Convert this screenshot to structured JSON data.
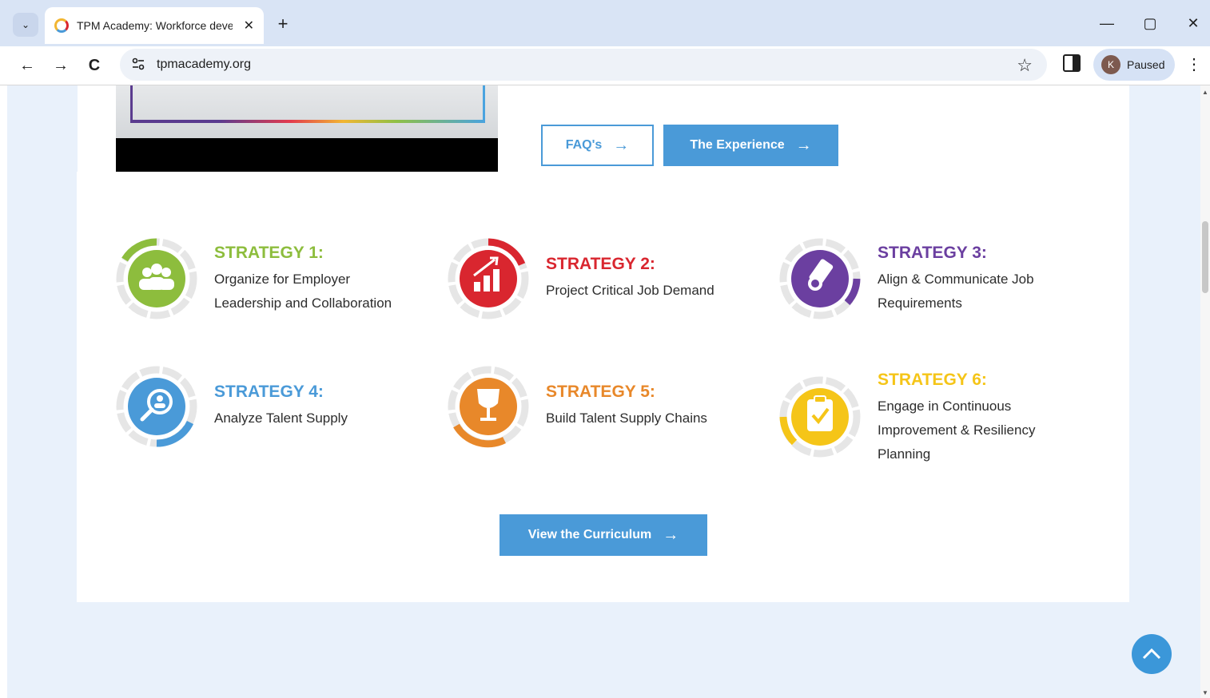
{
  "browser": {
    "tab_title": "TPM Academy: Workforce deve",
    "tab_close": "✕",
    "new_tab": "+",
    "tab_search": "⌄",
    "url": "tpmacademy.org",
    "profile_label": "Paused",
    "profile_initial": "K",
    "win_minimize": "—",
    "win_restore": "▢",
    "win_close": "✕",
    "back": "←",
    "forward": "→",
    "reload": "C",
    "star": "☆",
    "menu": "⋮"
  },
  "hero_buttons": {
    "faq_label": "FAQ's",
    "experience_label": "The Experience",
    "arrow": "→"
  },
  "strategies": [
    {
      "title": "STRATEGY 1:",
      "desc_lines": [
        "Organize for Employer",
        "Leadership and Collaboration"
      ],
      "color": "#8dbd3d",
      "icon": "people-group-icon"
    },
    {
      "title": "STRATEGY 2:",
      "desc_lines": [
        "Project Critical Job Demand"
      ],
      "color": "#d9262f",
      "icon": "chart-growth-icon"
    },
    {
      "title": "STRATEGY 3:",
      "desc_lines": [
        "Align & Communicate Job",
        "Requirements"
      ],
      "color": "#6b3fa0",
      "icon": "certificate-icon"
    },
    {
      "title": "STRATEGY 4:",
      "desc_lines": [
        "Analyze Talent Supply"
      ],
      "color": "#4a9ad8",
      "icon": "user-search-icon"
    },
    {
      "title": "STRATEGY 5:",
      "desc_lines": [
        "Build Talent Supply Chains"
      ],
      "color": "#e8882a",
      "icon": "trophy-icon"
    },
    {
      "title": "STRATEGY 6:",
      "desc_lines": [
        "Engage in Continuous",
        "Improvement & Resiliency",
        "Planning"
      ],
      "color": "#f5c518",
      "icon": "clipboard-check-icon"
    }
  ],
  "curriculum_button": {
    "label": "View the Curriculum",
    "arrow": "→"
  },
  "colors": {
    "accent": "#4a9ad8",
    "page_bg": "#e9f1fb"
  }
}
